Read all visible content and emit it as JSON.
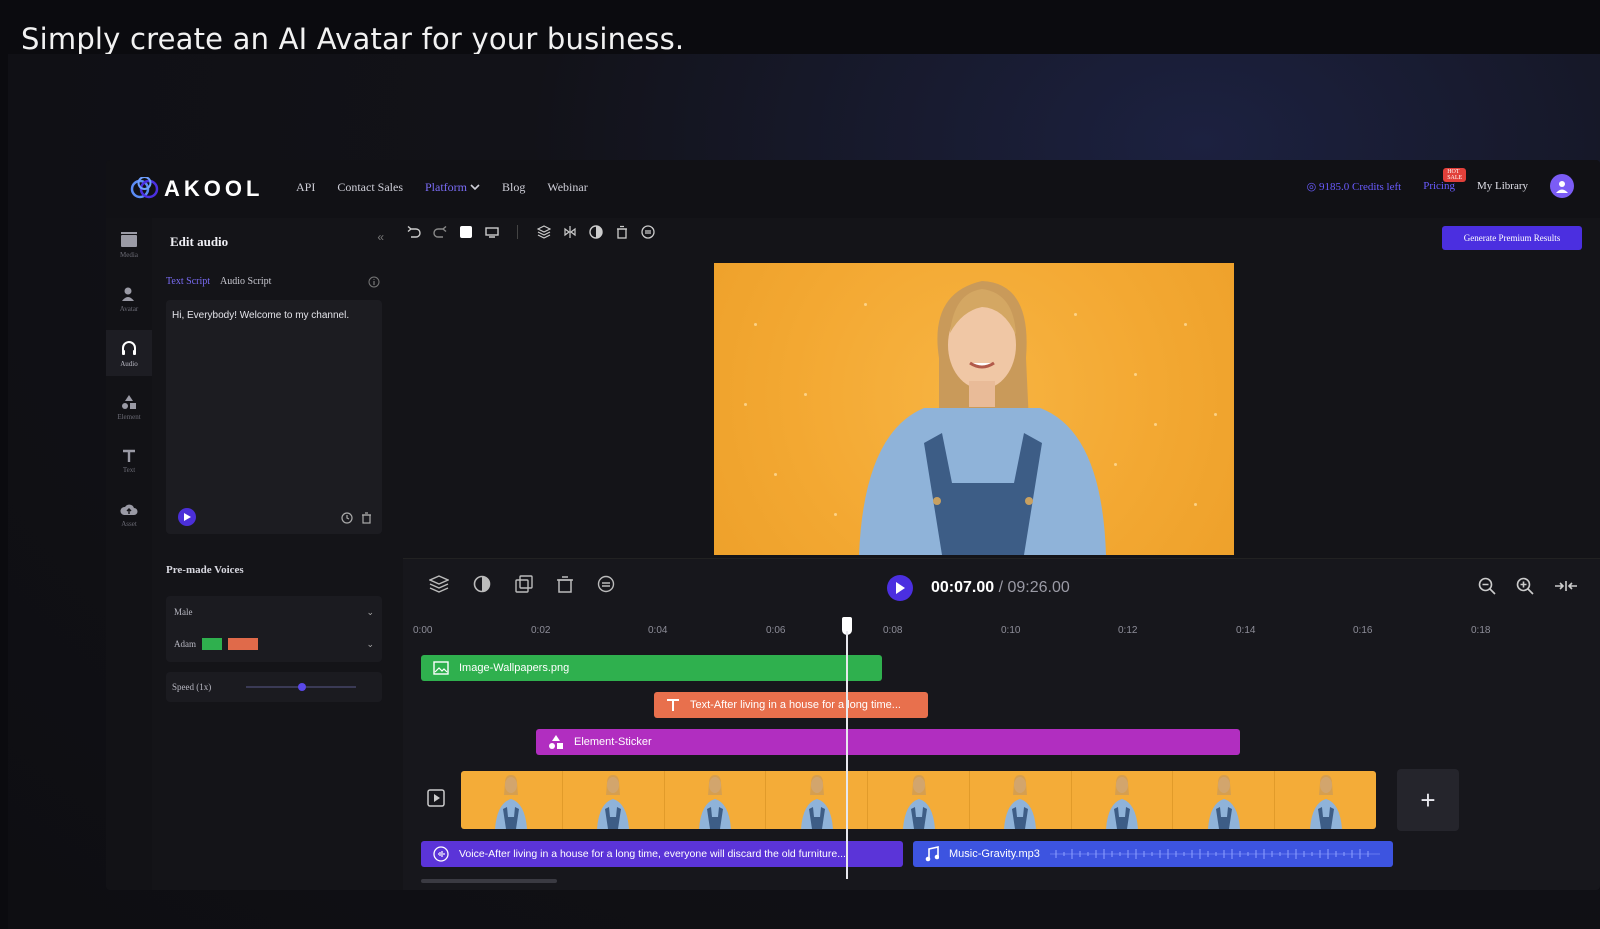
{
  "caption": "Simply create an AI Avatar for your business.",
  "brand": {
    "name": "AKOOL",
    "accent": "#4b2fe0"
  },
  "nav": {
    "links": [
      "API",
      "Contact Sales",
      "Platform",
      "Blog",
      "Webinar"
    ],
    "credits": "9185.0 Credits left",
    "pricing": "Pricing",
    "hot_badge": "HOT SALE",
    "my_library": "My Library"
  },
  "rail": [
    {
      "label": "Media",
      "icon": "media-icon"
    },
    {
      "label": "Avatar",
      "icon": "avatar-icon"
    },
    {
      "label": "Audio",
      "icon": "headphones-icon",
      "active": true
    },
    {
      "label": "Element",
      "icon": "shapes-icon"
    },
    {
      "label": "Text",
      "icon": "text-icon"
    },
    {
      "label": "Asset",
      "icon": "cloud-upload-icon"
    }
  ],
  "panel": {
    "title": "Edit audio",
    "tabs": [
      "Text Script",
      "Audio Script"
    ],
    "script_text": "Hi, Everybody! Welcome to my channel.",
    "voices_title": "Pre-made Voices",
    "gender": "Male",
    "voice_name": "Adam",
    "speed_label": "Speed (1x)",
    "speed_value": 0.5
  },
  "generate_button": "Generate Premium Results",
  "timeline": {
    "current_time": "00:07.00",
    "total_time": " / 09:26.00",
    "ticks": [
      "0:00",
      "0:02",
      "0:04",
      "0:06",
      "0:08",
      "0:10",
      "0:12",
      "0:14",
      "0:16",
      "0:18"
    ],
    "clips": {
      "image": "Image-Wallpapers.png",
      "text": "Text-After living in a house for a long time...",
      "element": "Element-Sticker",
      "voice": "Voice-After living in a house for a long time, everyone will discard the old furniture...",
      "music": "Music-Gravity.mp3"
    },
    "colors": {
      "image": "#2fb04e",
      "text": "#e8704d",
      "element": "#b12ec0",
      "voice": "#5b34d8",
      "music": "#3d54e0"
    },
    "add_label": "+"
  }
}
